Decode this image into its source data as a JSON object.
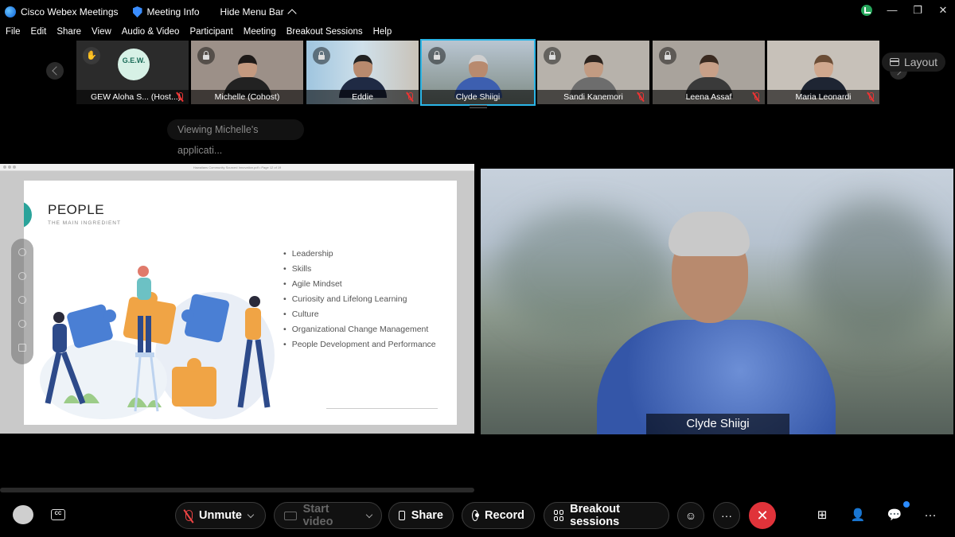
{
  "titlebar": {
    "app_name": "Cisco Webex Meetings",
    "meeting_info": "Meeting Info",
    "hide_menu": "Hide Menu Bar"
  },
  "menu": [
    "File",
    "Edit",
    "Share",
    "View",
    "Audio & Video",
    "Participant",
    "Meeting",
    "Breakout Sessions",
    "Help"
  ],
  "participants": [
    {
      "name": "GEW Aloha S... (Host...)",
      "muted": true,
      "logo_text": "G.E.W."
    },
    {
      "name": "Michelle  (Cohost)",
      "muted": false
    },
    {
      "name": "Eddie",
      "muted": true
    },
    {
      "name": "Clyde Shiigi",
      "muted": false,
      "active": true
    },
    {
      "name": "Sandi Kanemori",
      "muted": true
    },
    {
      "name": "Leena Assaf",
      "muted": true
    },
    {
      "name": "Maria Leonardi",
      "muted": true
    }
  ],
  "layout_label": "Layout",
  "viewing_label": "Viewing Michelle's applicati...",
  "shared": {
    "window_title": "Hawaiians Community Sourced Innovation.pdf • Page 12 of 19",
    "slide_title": "PEOPLE",
    "slide_subtitle": "THE MAIN INGREDIENT",
    "bullets": [
      "Leadership",
      "Skills",
      "Agile Mindset",
      "Curiosity and Lifelong Learning",
      "Culture",
      "Organizational Change Management",
      "People Development and Performance"
    ]
  },
  "speaker": {
    "name": "Clyde Shiigi"
  },
  "toolbar": {
    "cc": "CC",
    "unmute": "Unmute",
    "start_video": "Start video",
    "share": "Share",
    "record": "Record",
    "breakout": "Breakout sessions",
    "reactions_icon": "smiley-icon",
    "more": "···",
    "end": "✕"
  },
  "colors": {
    "active_outline": "#2bb5e6",
    "end_red": "#e0333a",
    "mute_red": "#e33333",
    "slide_teal": "#2aa39a",
    "badge_blue": "#2b8cff"
  }
}
